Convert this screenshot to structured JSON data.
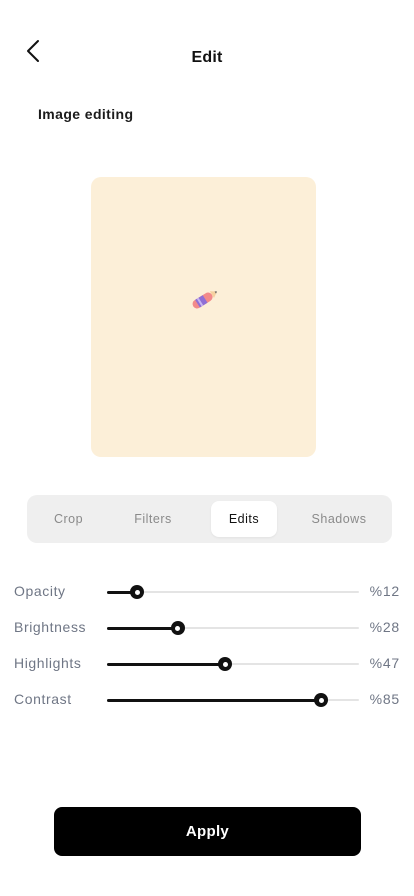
{
  "header": {
    "title": "Edit",
    "back_icon": "chevron-left-icon"
  },
  "section": {
    "title": "Image editing"
  },
  "preview": {
    "background_color": "#fcefd8",
    "image_icon": "crayon-sticker-icon"
  },
  "tabs": [
    {
      "label": "Crop",
      "active": false
    },
    {
      "label": "Filters",
      "active": false
    },
    {
      "label": "Edits",
      "active": true
    },
    {
      "label": "Shadows",
      "active": false
    }
  ],
  "sliders": [
    {
      "label": "Opacity",
      "value": 12,
      "display": "%12"
    },
    {
      "label": "Brightness",
      "value": 28,
      "display": "%28"
    },
    {
      "label": "Highlights",
      "value": 47,
      "display": "%47"
    },
    {
      "label": "Contrast",
      "value": 85,
      "display": "%85"
    }
  ],
  "actions": {
    "apply_label": "Apply"
  },
  "colors": {
    "accent": "#000000",
    "muted_text": "#6f7685",
    "tab_bar": "#efefef"
  }
}
